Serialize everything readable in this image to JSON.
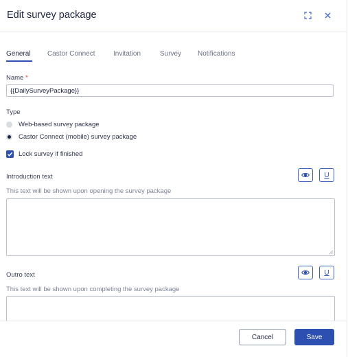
{
  "dialog": {
    "title": "Edit survey package"
  },
  "tabs": [
    "General",
    "Castor Connect",
    "Invitation",
    "Survey",
    "Notifications"
  ],
  "name": {
    "label": "Name",
    "required_mark": "*",
    "value": "{{DailySurveyPackage}}"
  },
  "type": {
    "label": "Type",
    "options": [
      "Web-based survey package",
      "Castor Connect (mobile) survey package"
    ],
    "selected": "Castor Connect (mobile) survey package"
  },
  "lock": {
    "label": "Lock survey if finished",
    "checked": true
  },
  "intro": {
    "label": "Introduction text",
    "help": "This text will be shown upon opening the survey package",
    "preview_icon": "eye-icon",
    "underline_label": "U"
  },
  "outro": {
    "label": "Outro text",
    "help": "This text will be shown upon completing the survey package",
    "preview_icon": "eye-icon",
    "underline_label": "U"
  },
  "footer": {
    "cancel_label": "Cancel",
    "save_label": "Save"
  },
  "colors": {
    "accent": "#2c4fb1",
    "required": "#d43a3a"
  }
}
